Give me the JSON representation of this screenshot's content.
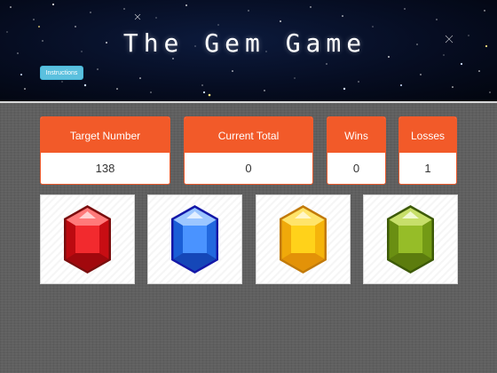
{
  "app": {
    "title": "The Gem Game",
    "instructions_label": "Instructions"
  },
  "scoreboard": {
    "target": {
      "label": "Target Number",
      "value": "138"
    },
    "current": {
      "label": "Current Total",
      "value": "0"
    },
    "wins": {
      "label": "Wins",
      "value": "0"
    },
    "losses": {
      "label": "Losses",
      "value": "1"
    }
  },
  "gems": [
    {
      "name": "red-gem-icon",
      "color": "#e8141b"
    },
    {
      "name": "blue-gem-icon",
      "color": "#2f7cf0"
    },
    {
      "name": "yellow-gem-icon",
      "color": "#f7c30c"
    },
    {
      "name": "green-gem-icon",
      "color": "#7ea51a"
    }
  ],
  "colors": {
    "accent": "#f25a29",
    "button": "#5bc0de"
  }
}
